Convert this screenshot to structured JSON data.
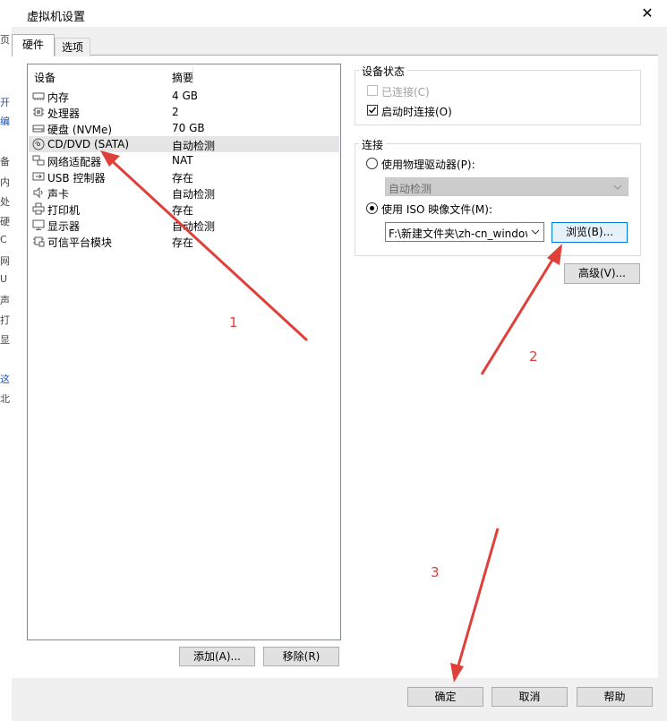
{
  "window": {
    "title": "虚拟机设置",
    "close_glyph": "✕"
  },
  "tabs": [
    {
      "label": "硬件"
    },
    {
      "label": "选项"
    }
  ],
  "bg_glyphs": [
    "页",
    "开",
    "编",
    "备",
    "内",
    "处",
    "硬",
    "C",
    "网",
    "U",
    "声",
    "打",
    "显",
    "这",
    "北"
  ],
  "device_list": {
    "headers": {
      "device": "设备",
      "summary": "摘要"
    },
    "rows": [
      {
        "name": "内存",
        "summary": "4 GB",
        "icon": "memory-icon"
      },
      {
        "name": "处理器",
        "summary": "2",
        "icon": "processor-icon"
      },
      {
        "name": "硬盘 (NVMe)",
        "summary": "70 GB",
        "icon": "harddisk-icon"
      },
      {
        "name": "CD/DVD (SATA)",
        "summary": "自动检测",
        "icon": "cd-dvd-icon",
        "selected": true
      },
      {
        "name": "网络适配器",
        "summary": "NAT",
        "icon": "network-adapter-icon"
      },
      {
        "name": "USB 控制器",
        "summary": "存在",
        "icon": "usb-icon"
      },
      {
        "name": "声卡",
        "summary": "自动检测",
        "icon": "sound-icon"
      },
      {
        "name": "打印机",
        "summary": "存在",
        "icon": "printer-icon"
      },
      {
        "name": "显示器",
        "summary": "自动检测",
        "icon": "display-icon"
      },
      {
        "name": "可信平台模块",
        "summary": "存在",
        "icon": "tpm-icon"
      }
    ]
  },
  "list_buttons": {
    "add": "添加(A)...",
    "remove": "移除(R)"
  },
  "device_status": {
    "title": "设备状态",
    "connected": {
      "label": "已连接(C)",
      "checked": false,
      "disabled": true
    },
    "connect_at_power_on": {
      "label": "启动时连接(O)",
      "checked": true
    }
  },
  "connection": {
    "title": "连接",
    "physical_drive": {
      "label": "使用物理驱动器(P):",
      "selected": false
    },
    "physical_drive_select": {
      "value": "自动检测"
    },
    "iso_image": {
      "label": "使用 ISO 映像文件(M):",
      "selected": true
    },
    "iso_path": {
      "value": "F:\\新建文件夹\\zh-cn_window"
    },
    "browse_button": "浏览(B)..."
  },
  "advanced_button": "高级(V)...",
  "footer": {
    "ok": "确定",
    "cancel": "取消",
    "help": "帮助"
  },
  "annotations": {
    "one": "1",
    "two": "2",
    "three": "3",
    "color": "#e0403a"
  }
}
